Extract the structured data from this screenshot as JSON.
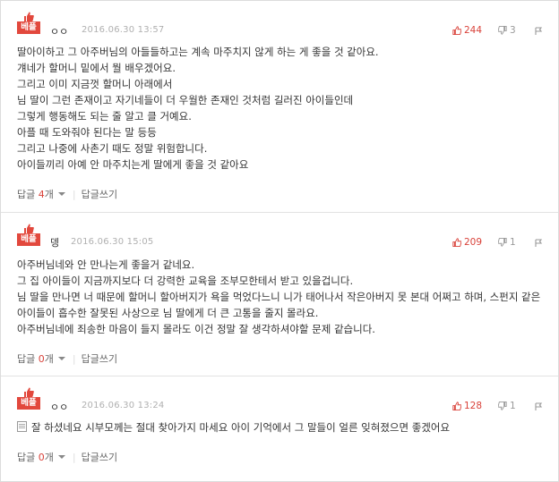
{
  "badge_label": "베플",
  "reply_label": "답글",
  "reply_count_suffix": "개",
  "write_reply_label": "답글쓰기",
  "colors": {
    "accent": "#e2483d",
    "upvote": "#d9423a",
    "muted": "#999999"
  },
  "comments": [
    {
      "nickname": "ㅇㅇ",
      "date": "2016.06.30 13:57",
      "likes": "244",
      "dislikes": "3",
      "lines": [
        "딸아이하고 그 아주버님의 아들들하고는 계속 마주치지 않게 하는 게 좋을 것 같아요.",
        "걔네가 할머니 밑에서 뭘 배우겠어요.",
        "그리고 이미 지금껏 할머니 아래에서",
        "님 딸이 그런 존재이고 자기네들이 더 우월한 존재인 것처럼 길러진 아이들인데",
        "그렇게 행동해도 되는 줄 알고 클 거예요.",
        "아플 때 도와줘야 된다는 말 등등",
        "그리고 나중에 사촌기 때도 정말 위험합니다.",
        "아이들끼리 아예 안 마주치는게 딸에게 좋을 것 같아요"
      ],
      "reply_count": "4"
    },
    {
      "nickname": "뎅",
      "date": "2016.06.30 15:05",
      "likes": "209",
      "dislikes": "1",
      "lines": [
        "아주버님네와 안 만나는게 좋을거 같네요.",
        "그 집 아이들이 지금까지보다 더 강력한 교육을 조부모한테서 받고 있을겁니다.",
        "님 딸을 만나면 너 때문에 할머니 할아버지가 욕을 먹었다느니 니가 태어나서 작은아버지 못 본대 어쩌고 하며, 스펀지 같은 아이들이 흡수한 잘못된 사상으로 님 딸에게 더 큰 고통을 줄지 몰라요.",
        "아주버님네에 죄송한 마음이 들지 몰라도 이건 정말 잘 생각하셔야할 문제 같습니다."
      ],
      "reply_count": "0"
    },
    {
      "nickname": "ㅇㅇ",
      "date": "2016.06.30 13:24",
      "likes": "128",
      "dislikes": "1",
      "lines": [
        "잘 하셨네요 시부모께는 절대 찾아가지 마세요 아이 기억에서 그 말들이 얼른 잊혀졌으면 좋겠어요"
      ],
      "reply_count": "0"
    }
  ]
}
